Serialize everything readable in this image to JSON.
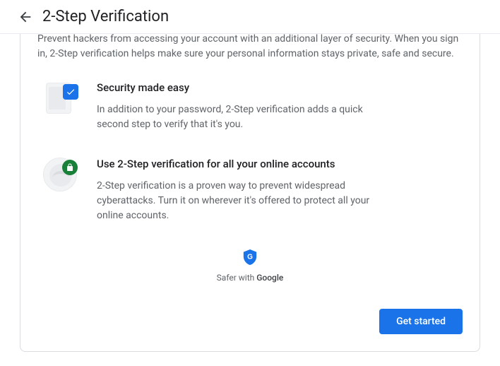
{
  "header": {
    "title": "2-Step Verification"
  },
  "intro": "Prevent hackers from accessing your account with an additional layer of security. When you sign in, 2-Step verification helps make sure your personal information stays private, safe and secure.",
  "features": [
    {
      "heading": "Security made easy",
      "body": "In addition to your password, 2-Step verification adds a quick second step to verify that it's you."
    },
    {
      "heading": "Use 2-Step verification for all your online accounts",
      "body": "2-Step verification is a proven way to prevent widespread cyberattacks. Turn it on wherever it's offered to protect all your online accounts."
    }
  ],
  "safer_prefix": "Safer with ",
  "safer_brand": "Google",
  "cta": "Get started"
}
